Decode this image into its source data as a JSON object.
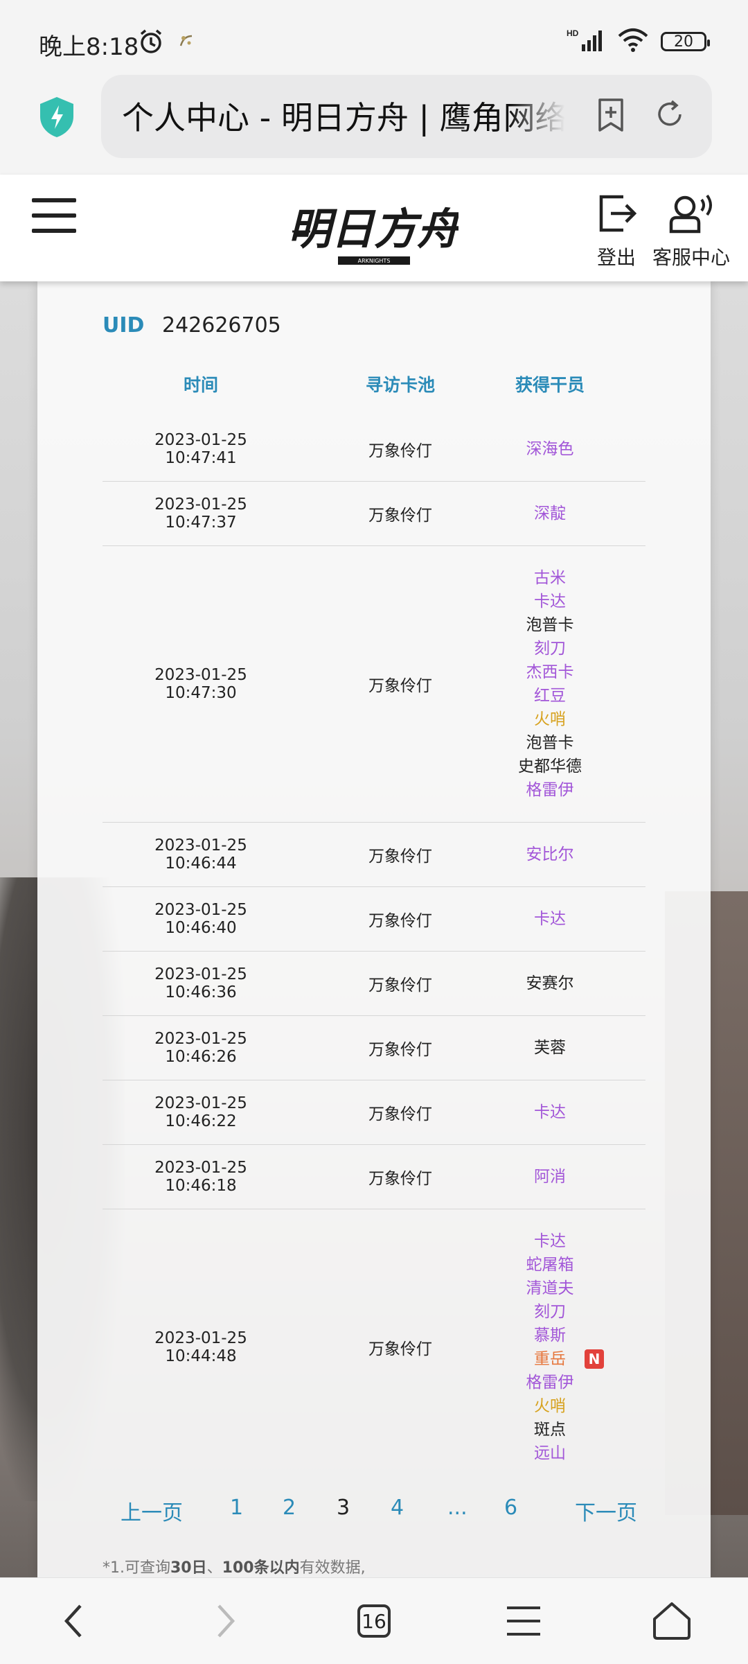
{
  "status_bar": {
    "time": "晚上8:18",
    "network": "HD",
    "battery": "20"
  },
  "browser": {
    "title": "个人中心 - 明日方舟 | 鹰角网络",
    "tabs_count": "16"
  },
  "header": {
    "logo_text": "明日方舟",
    "logo_subtext": "ARKNIGHTS",
    "logout_label": "登出",
    "service_label": "客服中心"
  },
  "uid": {
    "label": "UID",
    "value": "242626705"
  },
  "table": {
    "headers": [
      "时间",
      "寻访卡池",
      "获得干员"
    ],
    "rows": [
      {
        "time": "2023-01-25 10:47:41",
        "pool": "万象伶仃",
        "operators": [
          {
            "name": "深海色",
            "rarity": "purple"
          }
        ]
      },
      {
        "time": "2023-01-25 10:47:37",
        "pool": "万象伶仃",
        "operators": [
          {
            "name": "深靛",
            "rarity": "purple"
          }
        ]
      },
      {
        "time": "2023-01-25 10:47:30",
        "pool": "万象伶仃",
        "operators": [
          {
            "name": "古米",
            "rarity": "purple"
          },
          {
            "name": "卡达",
            "rarity": "purple"
          },
          {
            "name": "泡普卡",
            "rarity": "black"
          },
          {
            "name": "刻刀",
            "rarity": "purple"
          },
          {
            "name": "杰西卡",
            "rarity": "purple"
          },
          {
            "name": "红豆",
            "rarity": "purple"
          },
          {
            "name": "火哨",
            "rarity": "gold"
          },
          {
            "name": "泡普卡",
            "rarity": "black"
          },
          {
            "name": "史都华德",
            "rarity": "black"
          },
          {
            "name": "格雷伊",
            "rarity": "purple"
          }
        ]
      },
      {
        "time": "2023-01-25 10:46:44",
        "pool": "万象伶仃",
        "operators": [
          {
            "name": "安比尔",
            "rarity": "purple"
          }
        ]
      },
      {
        "time": "2023-01-25 10:46:40",
        "pool": "万象伶仃",
        "operators": [
          {
            "name": "卡达",
            "rarity": "purple"
          }
        ]
      },
      {
        "time": "2023-01-25 10:46:36",
        "pool": "万象伶仃",
        "operators": [
          {
            "name": "安赛尔",
            "rarity": "black"
          }
        ]
      },
      {
        "time": "2023-01-25 10:46:26",
        "pool": "万象伶仃",
        "operators": [
          {
            "name": "芙蓉",
            "rarity": "black"
          }
        ]
      },
      {
        "time": "2023-01-25 10:46:22",
        "pool": "万象伶仃",
        "operators": [
          {
            "name": "卡达",
            "rarity": "purple"
          }
        ]
      },
      {
        "time": "2023-01-25 10:46:18",
        "pool": "万象伶仃",
        "operators": [
          {
            "name": "阿消",
            "rarity": "purple"
          }
        ]
      },
      {
        "time": "2023-01-25 10:44:48",
        "pool": "万象伶仃",
        "operators": [
          {
            "name": "卡达",
            "rarity": "purple"
          },
          {
            "name": "蛇屠箱",
            "rarity": "purple"
          },
          {
            "name": "清道夫",
            "rarity": "purple"
          },
          {
            "name": "刻刀",
            "rarity": "purple"
          },
          {
            "name": "慕斯",
            "rarity": "purple"
          },
          {
            "name": "重岳",
            "rarity": "orange",
            "badge": "N"
          },
          {
            "name": "格雷伊",
            "rarity": "purple"
          },
          {
            "name": "火哨",
            "rarity": "gold"
          },
          {
            "name": "斑点",
            "rarity": "black"
          },
          {
            "name": "远山",
            "rarity": "purple"
          }
        ]
      }
    ]
  },
  "pagination": {
    "prev": "上一页",
    "pages": [
      "1",
      "2",
      "3",
      "4",
      "...",
      "6"
    ],
    "current": "3",
    "next": "下一页"
  },
  "note": {
    "prefix": "*1.可查询",
    "bold1": "30日",
    "sep": "、",
    "bold2": "100条以内",
    "suffix": "有效数据,"
  },
  "colors": {
    "accent": "#2b8bb8",
    "rarity_purple": "#a256d8",
    "rarity_gold": "#d7a21f",
    "rarity_orange": "#e6763c",
    "badge_new": "#e2413b"
  }
}
